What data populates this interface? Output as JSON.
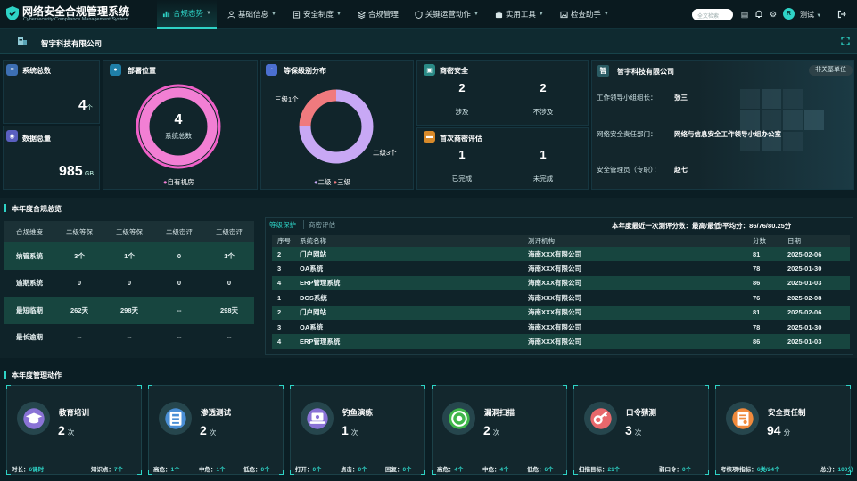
{
  "app": {
    "title": "网络安全合规管理系统",
    "subtitle": "Cybersecurity Compliance Management System"
  },
  "nav": [
    {
      "label": "合规态势",
      "icon": "chart-icon",
      "active": true,
      "dropdown": true
    },
    {
      "label": "基础信息",
      "icon": "person-icon",
      "dropdown": true
    },
    {
      "label": "安全制度",
      "icon": "doc-icon",
      "dropdown": true
    },
    {
      "label": "合规管理",
      "icon": "stack-icon",
      "dropdown": false
    },
    {
      "label": "关键运营动作",
      "icon": "shield-icon",
      "dropdown": true
    },
    {
      "label": "实用工具",
      "icon": "toolbox-icon",
      "dropdown": true
    },
    {
      "label": "检查助手",
      "icon": "image-icon",
      "dropdown": true
    }
  ],
  "header": {
    "search_placeholder": "全文检索",
    "avatar_letter": "R",
    "user": "测试"
  },
  "company_bar": {
    "name": "智宇科技有限公司"
  },
  "stats": {
    "system_total_label": "系统总数",
    "system_total": "4",
    "system_total_unit": "个",
    "data_total_label": "数据总量",
    "data_total": "985",
    "data_total_unit": "GB"
  },
  "deploy": {
    "title": "部署位置",
    "center_value": "4",
    "center_label": "系统总数",
    "legend": "自有机房"
  },
  "grade": {
    "title": "等保级别分布",
    "label_l3": "三级1个",
    "label_l2": "二级3个",
    "legend_l2": "二级",
    "legend_l3": "三级",
    "colors": {
      "l2": "#c8a8f5",
      "l3": "#f07a7e"
    }
  },
  "chart_data": {
    "type": "pie",
    "categories": [
      "二级",
      "三级"
    ],
    "values": [
      3,
      1
    ]
  },
  "crypto": {
    "title": "商密安全",
    "involved_value": "2",
    "involved_label": "涉及",
    "not_involved_value": "2",
    "not_involved_label": "不涉及",
    "eval_title": "首次商密评估",
    "done_value": "1",
    "done_label": "已完成",
    "undone_value": "1",
    "undone_label": "未完成"
  },
  "org": {
    "name": "智宇科技有限公司",
    "badge": "非关基单位",
    "rows": [
      {
        "k": "工作领导小组组长：",
        "v": "张三"
      },
      {
        "k": "网络安全责任部门：",
        "v": "网络与信息安全工作领导小组办公室"
      },
      {
        "k": "安全管理员（专职）：",
        "v": "赵七"
      }
    ]
  },
  "compliance": {
    "title": "本年度合规总览",
    "headers": [
      "合规维度",
      "二级等保",
      "三级等保",
      "二级密评",
      "三级密评"
    ],
    "rows": [
      [
        "纳管系统",
        "3个",
        "1个",
        "0",
        "1个"
      ],
      [
        "逾期系统",
        "0",
        "0",
        "0",
        "0"
      ],
      [
        "最短临期",
        "262天",
        "298天",
        "--",
        "298天"
      ],
      [
        "最长逾期",
        "--",
        "--",
        "--",
        "--"
      ]
    ]
  },
  "records": {
    "tabs": [
      "等级保护",
      "商密评估"
    ],
    "score_summary": "本年度最近一次测评分数：最高/最低/平均分：86/76/80.25分",
    "headers": [
      "序号",
      "系统名称",
      "测评机构",
      "分数",
      "日期"
    ],
    "rows": [
      [
        "2",
        "门户网站",
        "海南XXX有限公司",
        "81",
        "2025-02-06"
      ],
      [
        "3",
        "OA系统",
        "海南XXX有限公司",
        "78",
        "2025-01-30"
      ],
      [
        "4",
        "ERP管理系统",
        "海南XXX有限公司",
        "86",
        "2025-01-03"
      ],
      [
        "1",
        "DCS系统",
        "海南XXX有限公司",
        "76",
        "2025-02-08"
      ],
      [
        "2",
        "门户网站",
        "海南XXX有限公司",
        "81",
        "2025-02-06"
      ],
      [
        "3",
        "OA系统",
        "海南XXX有限公司",
        "78",
        "2025-01-30"
      ],
      [
        "4",
        "ERP管理系统",
        "海南XXX有限公司",
        "86",
        "2025-01-03"
      ]
    ]
  },
  "actions": {
    "title": "本年度管理动作",
    "cards": [
      {
        "name": "教育培训",
        "value": "2",
        "unit": "次",
        "icon": "graduation-cap-icon",
        "icon_bg": "#8a73d6",
        "foot": [
          {
            "k": "时长：",
            "v": "6课时"
          },
          {
            "k": "知识点：",
            "v": "7个"
          }
        ]
      },
      {
        "name": "渗透测试",
        "value": "2",
        "unit": "次",
        "icon": "server-icon",
        "icon_bg": "#4a8fd6",
        "foot": [
          {
            "k": "高危：",
            "v": "1个"
          },
          {
            "k": "中危：",
            "v": "1个"
          },
          {
            "k": "低危：",
            "v": "0个"
          }
        ]
      },
      {
        "name": "钓鱼演练",
        "value": "1",
        "unit": "次",
        "icon": "laptop-icon",
        "icon_bg": "#8a73d6",
        "foot": [
          {
            "k": "打开：",
            "v": "0个"
          },
          {
            "k": "点击：",
            "v": "0个"
          },
          {
            "k": "回复：",
            "v": "0个"
          }
        ]
      },
      {
        "name": "漏洞扫描",
        "value": "2",
        "unit": "次",
        "icon": "target-icon",
        "icon_bg": "#3fb64a",
        "foot": [
          {
            "k": "高危：",
            "v": "4个"
          },
          {
            "k": "中危：",
            "v": "4个"
          },
          {
            "k": "低危：",
            "v": "6个"
          }
        ]
      },
      {
        "name": "口令猜测",
        "value": "3",
        "unit": "次",
        "icon": "key-icon",
        "icon_bg": "#e8686c",
        "foot": [
          {
            "k": "扫描目标：",
            "v": "21个"
          },
          {
            "k": "弱口令：",
            "v": "0个"
          }
        ]
      },
      {
        "name": "安全责任制",
        "value": "94",
        "unit": "分",
        "icon": "certificate-icon",
        "icon_bg": "#f08a3c",
        "foot": [
          {
            "k": "考核项/指标：",
            "v": "6类/24个"
          },
          {
            "k": "总分：",
            "v": "100分"
          }
        ]
      }
    ]
  }
}
